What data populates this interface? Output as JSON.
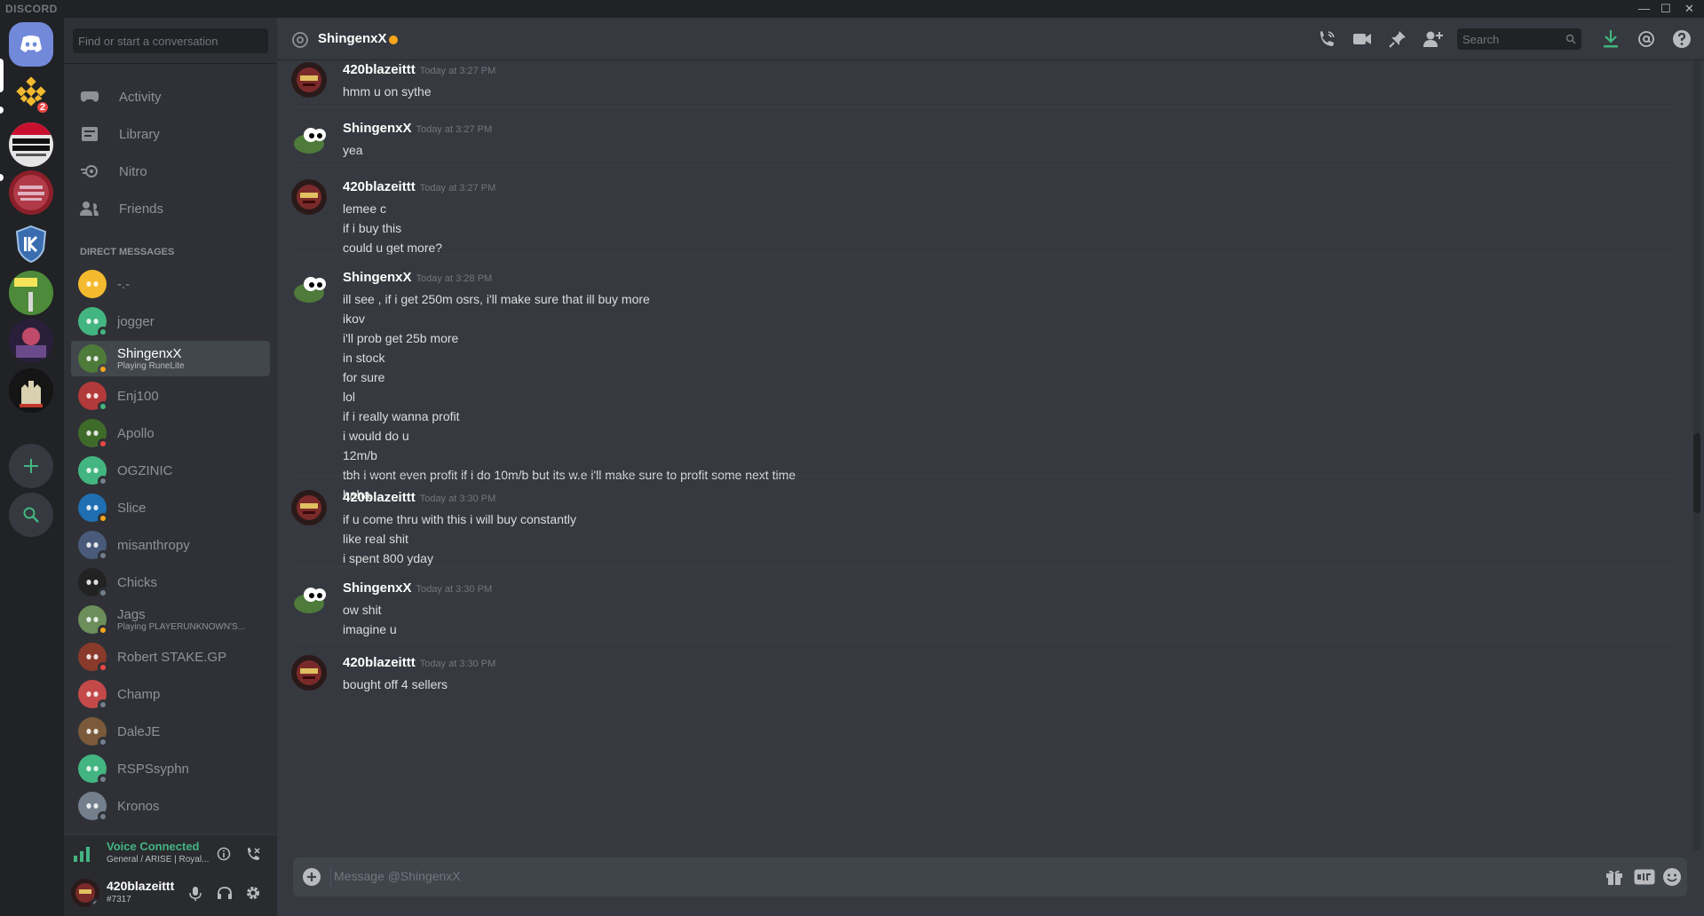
{
  "window": {
    "brand": "DISCORD",
    "controls": [
      "—",
      "☐",
      "✕"
    ]
  },
  "guilds": {
    "home_icon": "discord-logo-icon",
    "binance_badge": "2",
    "add_server_icon": "plus-icon",
    "explore_icon": "search-icon"
  },
  "dm_sidebar": {
    "search_placeholder": "Find or start a conversation",
    "nav": [
      {
        "label": "Activity",
        "icon": "gamepad-icon"
      },
      {
        "label": "Library",
        "icon": "library-icon"
      },
      {
        "label": "Nitro",
        "icon": "nitro-icon"
      },
      {
        "label": "Friends",
        "icon": "friends-icon"
      }
    ],
    "direct_messages_header": "DIRECT MESSAGES",
    "dms": [
      {
        "name": "-.-",
        "sub": "",
        "status": "none",
        "avatar_color": "#f3ba2f"
      },
      {
        "name": "jogger",
        "sub": "",
        "status": "online",
        "avatar_color": "#43b581"
      },
      {
        "name": "ShingenxX",
        "sub": "Playing RuneLite",
        "status": "idle",
        "avatar_color": "#4e7a3a"
      },
      {
        "name": "Enj100",
        "sub": "",
        "status": "online",
        "avatar_color": "#b33a3a"
      },
      {
        "name": "Apollo",
        "sub": "",
        "status": "dnd",
        "avatar_color": "#3f6b2a"
      },
      {
        "name": "OGZINIC",
        "sub": "",
        "status": "offline",
        "avatar_color": "#43b581"
      },
      {
        "name": "Slice",
        "sub": "",
        "status": "idle",
        "avatar_color": "#1f6fb2"
      },
      {
        "name": "misanthropy",
        "sub": "",
        "status": "offline",
        "avatar_color": "#4a5a7a"
      },
      {
        "name": "Chicks",
        "sub": "",
        "status": "offline",
        "avatar_color": "#222222"
      },
      {
        "name": "Jags",
        "sub": "Playing PLAYERUNKNOWN'S...",
        "status": "idle",
        "avatar_color": "#6b8e5a"
      },
      {
        "name": "Robert STAKE.GP",
        "sub": "",
        "status": "dnd",
        "avatar_color": "#8a3a2a"
      },
      {
        "name": "Champ",
        "sub": "",
        "status": "offline",
        "avatar_color": "#c44a4a"
      },
      {
        "name": "DaleJE",
        "sub": "",
        "status": "offline",
        "avatar_color": "#7a5a3a"
      },
      {
        "name": "RSPSsyphn",
        "sub": "",
        "status": "offline",
        "avatar_color": "#43b581"
      },
      {
        "name": "Kronos",
        "sub": "",
        "status": "offline",
        "avatar_color": "#747f8d"
      }
    ],
    "voice": {
      "status": "Voice Connected",
      "channel": "General / ARISE | Royal..."
    },
    "user": {
      "name": "420blazeittt",
      "tag": "#7317"
    }
  },
  "chat": {
    "recipient": "ShingenxX",
    "search_placeholder": "Search",
    "composer_placeholder": "Message @ShingenxX",
    "messages": [
      {
        "author": "420blazeittt",
        "time": "Today at 3:27 PM",
        "lines": [
          "hmm u on sythe"
        ]
      },
      {
        "author": "ShingenxX",
        "time": "Today at 3:27 PM",
        "lines": [
          "yea"
        ]
      },
      {
        "author": "420blazeittt",
        "time": "Today at 3:27 PM",
        "lines": [
          "lemee c",
          "if i buy this",
          "could u get more?"
        ]
      },
      {
        "author": "ShingenxX",
        "time": "Today at 3:28 PM",
        "lines": [
          "ill see , if i get 250m osrs, i'll make sure that ill buy more",
          "ikov",
          "i'll prob get 25b more",
          "in stock",
          "for sure",
          "lol",
          "if i really wanna profit",
          "i would do u",
          "12m/b",
          "tbh i wont even profit if i do 10m/b but its w.e i'll make sure to profit some next time",
          "haha"
        ]
      },
      {
        "author": "420blazeittt",
        "time": "Today at 3:30 PM",
        "lines": [
          "if u come thru with this i will buy constantly",
          "like real shit",
          "i spent 800 yday"
        ]
      },
      {
        "author": "ShingenxX",
        "time": "Today at 3:30 PM",
        "lines": [
          "ow shit",
          "imagine u"
        ]
      },
      {
        "author": "420blazeittt",
        "time": "Today at 3:30 PM",
        "lines": [
          "bought off 4 sellers"
        ]
      }
    ]
  },
  "colors": {
    "online": "#43b581",
    "idle": "#faa61a",
    "dnd": "#f04747",
    "offline": "#747f8d",
    "blurple": "#7289da",
    "voice_green": "#43b581"
  }
}
